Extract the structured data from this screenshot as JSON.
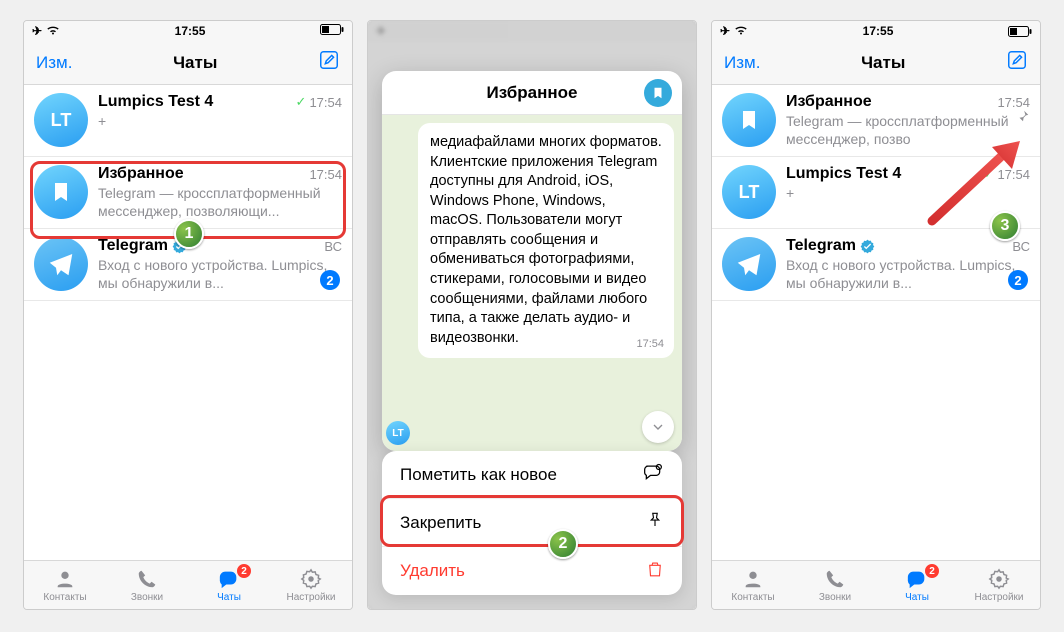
{
  "status": {
    "time": "17:55"
  },
  "nav": {
    "edit": "Изм.",
    "title": "Чаты"
  },
  "panel1": {
    "chats": [
      {
        "name": "Lumpics Test 4",
        "msg": "+",
        "time": "17:54",
        "checked": true
      },
      {
        "name": "Избранное",
        "msg": "Telegram — кроссплатформенный мессенджер, позволяющи...",
        "time": "17:54"
      },
      {
        "name": "Telegram",
        "msg": "Вход с нового устройства. Lumpics, мы обнаружили в...",
        "time": "ВС",
        "badge": "2",
        "verified": true
      }
    ]
  },
  "panel2": {
    "title": "Избранное",
    "bubble": "медиафайлами многих форматов. Клиентские приложения Telegram доступны для Android, iOS, Windows Phone, Windows, macOS. Пользователи могут отправлять сообщения и обмениваться фотографиями, стикерами, голосовыми и видео сообщениями, файлами любого типа, а также делать аудио- и видеозвонки.",
    "bubble_time": "17:54",
    "mini_av": "LT",
    "actions": {
      "mark": "Пометить как новое",
      "pin": "Закрепить",
      "delete": "Удалить"
    }
  },
  "panel3": {
    "chats": [
      {
        "name": "Избранное",
        "msg": "Telegram — кроссплатформенный мессенджер, позво",
        "time": "17:54",
        "pinned": true
      },
      {
        "name": "Lumpics Test 4",
        "msg": "+",
        "time": "17:54",
        "checked": true
      },
      {
        "name": "Telegram",
        "msg": "Вход с нового устройства. Lumpics, мы обнаружили в...",
        "time": "ВС",
        "badge": "2",
        "verified": true
      }
    ]
  },
  "tabs": {
    "contacts": "Контакты",
    "calls": "Звонки",
    "chats": "Чаты",
    "settings": "Настройки",
    "badge": "2"
  },
  "steps": {
    "s1": "1",
    "s2": "2",
    "s3": "3"
  }
}
